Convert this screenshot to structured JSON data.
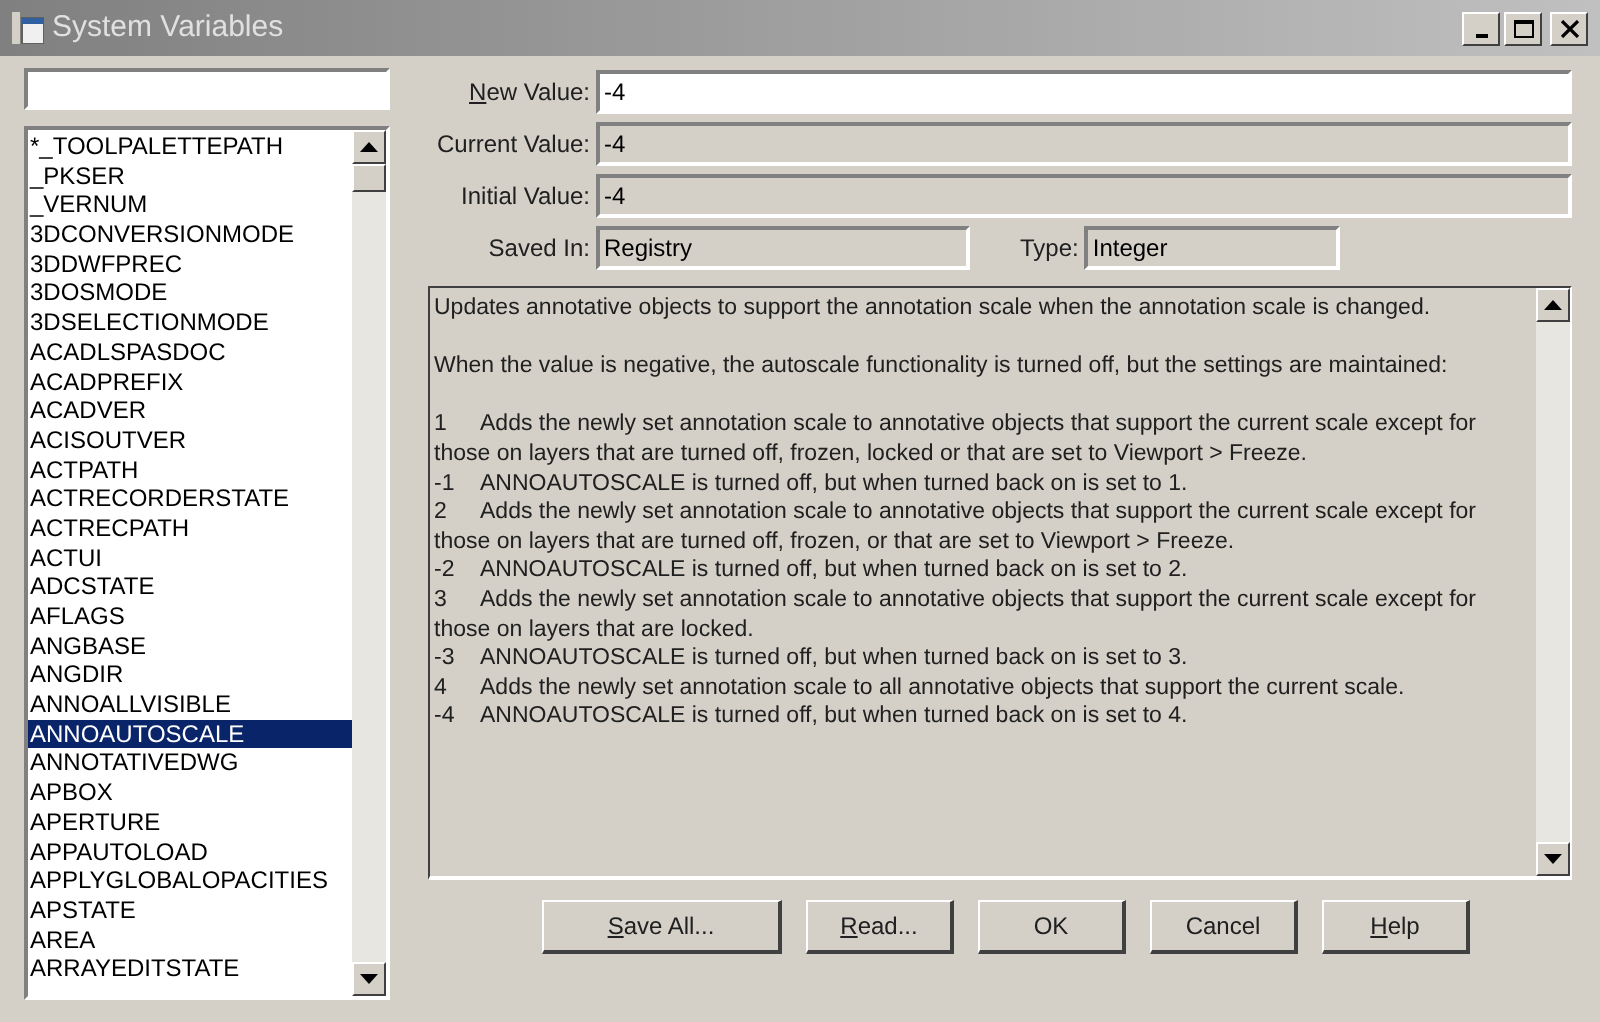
{
  "window": {
    "title": "System Variables",
    "active": false
  },
  "variables": [
    {
      "name": "*_TOOLPALETTEPATH",
      "selected": false
    },
    {
      "name": "_PKSER",
      "selected": false
    },
    {
      "name": "_VERNUM",
      "selected": false
    },
    {
      "name": "3DCONVERSIONMODE",
      "selected": false
    },
    {
      "name": "3DDWFPREC",
      "selected": false
    },
    {
      "name": "3DOSMODE",
      "selected": false
    },
    {
      "name": "3DSELECTIONMODE",
      "selected": false
    },
    {
      "name": "ACADLSPASDOC",
      "selected": false
    },
    {
      "name": "ACADPREFIX",
      "selected": false
    },
    {
      "name": "ACADVER",
      "selected": false
    },
    {
      "name": "ACISOUTVER",
      "selected": false
    },
    {
      "name": "ACTPATH",
      "selected": false
    },
    {
      "name": "ACTRECORDERSTATE",
      "selected": false
    },
    {
      "name": "ACTRECPATH",
      "selected": false
    },
    {
      "name": "ACTUI",
      "selected": false
    },
    {
      "name": "ADCSTATE",
      "selected": false
    },
    {
      "name": "AFLAGS",
      "selected": false
    },
    {
      "name": "ANGBASE",
      "selected": false
    },
    {
      "name": "ANGDIR",
      "selected": false
    },
    {
      "name": "ANNOALLVISIBLE",
      "selected": false
    },
    {
      "name": "ANNOAUTOSCALE",
      "selected": true
    },
    {
      "name": "ANNOTATIVEDWG",
      "selected": false
    },
    {
      "name": "APBOX",
      "selected": false
    },
    {
      "name": "APERTURE",
      "selected": false
    },
    {
      "name": "APPAUTOLOAD",
      "selected": false
    },
    {
      "name": "APPLYGLOBALOPACITIES",
      "selected": false
    },
    {
      "name": "APSTATE",
      "selected": false
    },
    {
      "name": "AREA",
      "selected": false
    },
    {
      "name": "ARRAYEDITSTATE",
      "selected": false
    }
  ],
  "new_value": {
    "label": "New Value:",
    "underline_first": true,
    "value": "-4"
  },
  "current_value": {
    "label": "Current Value:",
    "value": "-4"
  },
  "initial_value": {
    "label": "Initial Value:",
    "value": "-4"
  },
  "saved_in": {
    "label": "Saved In:",
    "value": "Registry"
  },
  "type": {
    "label": "Type:",
    "value": "Integer"
  },
  "description": {
    "paragraphs": [
      "Updates annotative objects to support the annotation scale when the annotation scale is changed.",
      "When the value is negative, the autoscale functionality is turned off, but the settings are maintained:"
    ],
    "options": [
      {
        "code": "1",
        "text": "Adds the newly set annotation scale to annotative objects that support the current scale except for those on layers that are turned off, frozen, locked or that are set to Viewport > Freeze."
      },
      {
        "code": "-1",
        "text": "ANNOAUTOSCALE is turned off, but when turned back on is set to 1."
      },
      {
        "code": "2",
        "text": "Adds the newly set annotation scale to annotative objects that support the current scale except for those on layers that are turned off, frozen, or that are set to Viewport > Freeze."
      },
      {
        "code": "-2",
        "text": "ANNOAUTOSCALE is turned off, but when turned back on is set to 2."
      },
      {
        "code": "3",
        "text": "Adds the newly set annotation scale to annotative objects that support the current scale except for those on layers that are locked."
      },
      {
        "code": "-3",
        "text": "ANNOAUTOSCALE is turned off, but when turned back on is set to 3."
      },
      {
        "code": "4",
        "text": "Adds the newly set annotation scale to all annotative objects that support the current scale."
      },
      {
        "code": "-4",
        "text": "ANNOAUTOSCALE is turned off, but when turned back on is set to 4."
      }
    ]
  },
  "buttons": [
    {
      "label": "Save All...",
      "underline_first": true
    },
    {
      "label": "Read...",
      "underline_first": true
    },
    {
      "label": "OK",
      "underline_first": false
    },
    {
      "label": "Cancel",
      "underline_first": false
    },
    {
      "label": "Help",
      "underline_first": true
    }
  ]
}
